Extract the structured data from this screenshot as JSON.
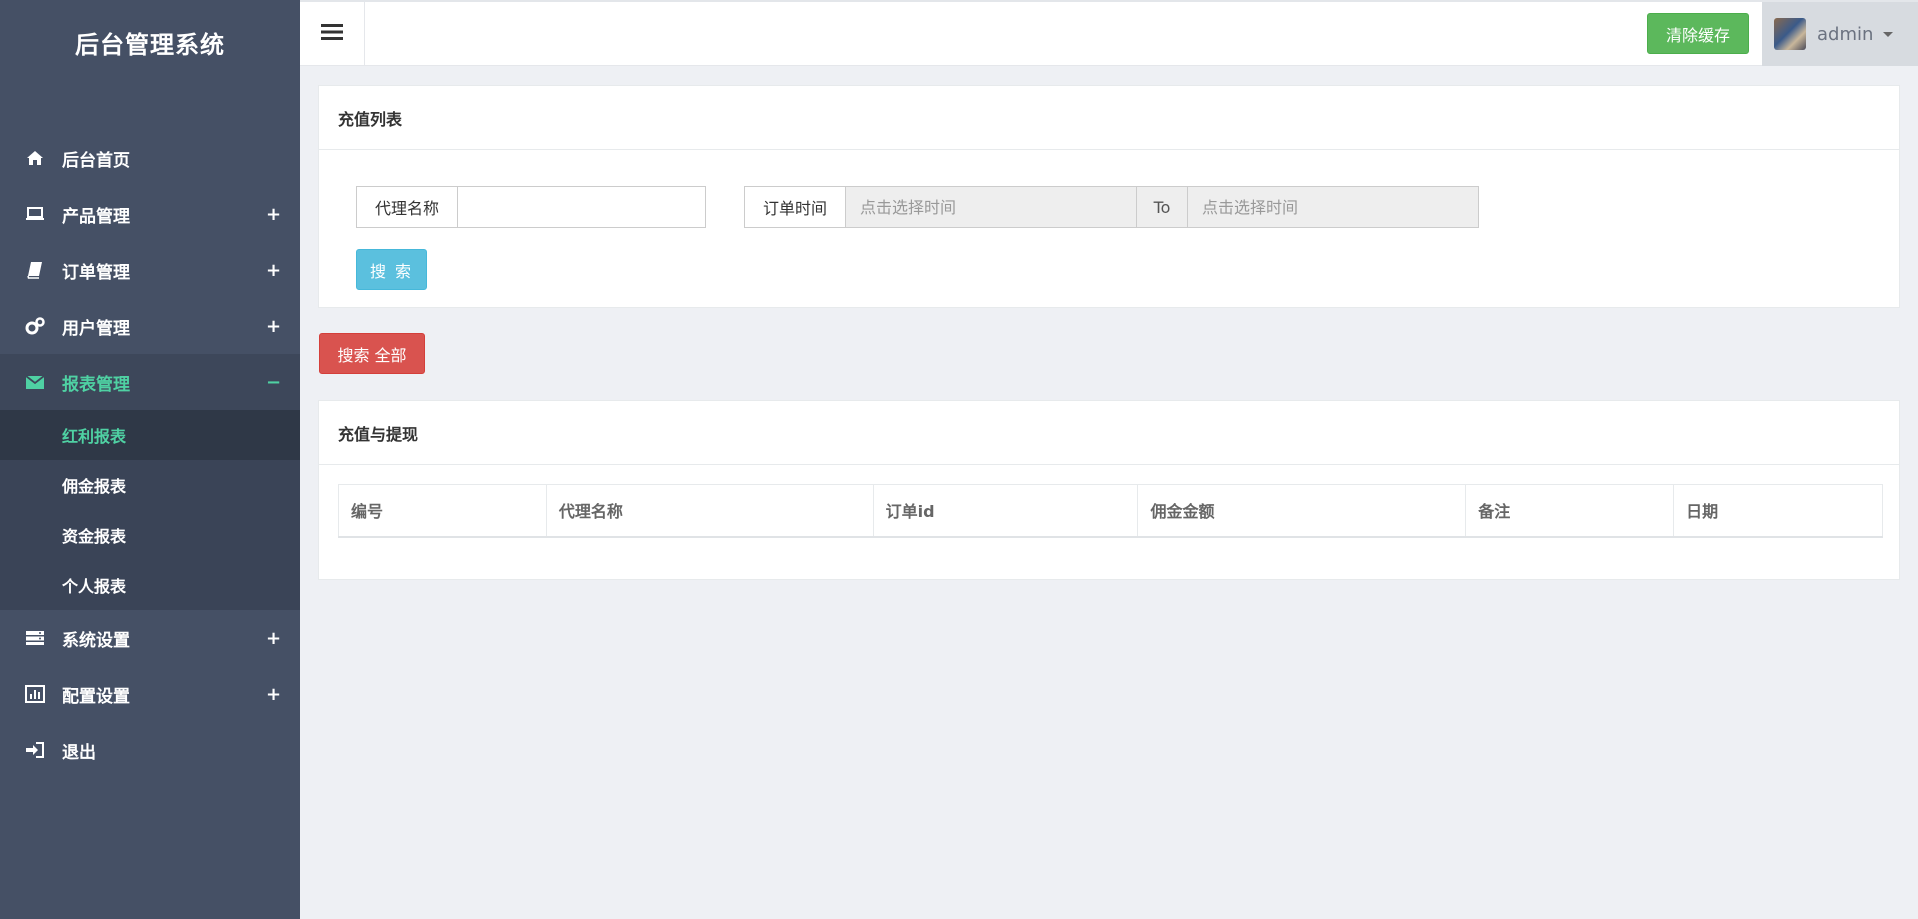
{
  "app_title": "后台管理系统",
  "sidebar": {
    "items": [
      {
        "label": "后台首页",
        "icon": "home-icon",
        "toggle": ""
      },
      {
        "label": "产品管理",
        "icon": "laptop-icon",
        "toggle": "+"
      },
      {
        "label": "订单管理",
        "icon": "book-icon",
        "toggle": "+"
      },
      {
        "label": "用户管理",
        "icon": "gears-icon",
        "toggle": "+"
      },
      {
        "label": "报表管理",
        "icon": "envelope-icon",
        "toggle": "−"
      },
      {
        "label": "系统设置",
        "icon": "server-icon",
        "toggle": "+"
      },
      {
        "label": "配置设置",
        "icon": "bar-chart-icon",
        "toggle": "+"
      },
      {
        "label": "退出",
        "icon": "sign-in-icon",
        "toggle": ""
      }
    ],
    "report_submenu": [
      "红利报表",
      "佣金报表",
      "资金报表",
      "个人报表"
    ],
    "active_color": "#4fd1a3"
  },
  "topbar": {
    "clear_cache": "清除缓存",
    "username": "admin"
  },
  "recharge_panel": {
    "title": "充值列表",
    "agent_label": "代理名称",
    "agent_value": "",
    "order_time_label": "订单时间",
    "time_placeholder": "点击选择时间",
    "to_label": "To",
    "search_button": "搜 索"
  },
  "search_all_button": "搜索 全部",
  "table_panel": {
    "title": "充值与提现",
    "columns": [
      "编号",
      "代理名称",
      "订单id",
      "佣金金额",
      "备注",
      "日期"
    ]
  }
}
